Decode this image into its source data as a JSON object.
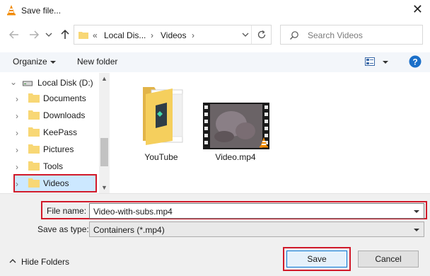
{
  "window": {
    "title": "Save file...",
    "icon": "vlc-cone-icon"
  },
  "nav": {
    "back_icon": "arrow-left-icon",
    "forward_icon": "arrow-right-icon",
    "recent_icon": "chevron-down-icon",
    "up_icon": "arrow-up-icon",
    "address": {
      "overflow": "«",
      "crumb1": "Local Dis...",
      "sep": "›",
      "crumb2": "Videos",
      "sep2": "›"
    },
    "search_placeholder": "Search Videos"
  },
  "toolbar": {
    "organize_label": "Organize",
    "new_folder_label": "New folder",
    "view_icon": "view-options-icon",
    "help_icon": "help-icon"
  },
  "tree": {
    "drive_label": "Local Disk (D:)",
    "items": [
      {
        "label": "Documents"
      },
      {
        "label": "Downloads"
      },
      {
        "label": "KeePass"
      },
      {
        "label": "Pictures"
      },
      {
        "label": "Tools"
      },
      {
        "label": "Videos",
        "selected": true
      }
    ]
  },
  "files": [
    {
      "name": "YouTube",
      "type": "folder"
    },
    {
      "name": "Video.mp4",
      "type": "video"
    }
  ],
  "form": {
    "file_name_label": "File name:",
    "file_name_value": "Video-with-subs.mp4",
    "save_as_type_label": "Save as type:",
    "save_as_type_value": "Containers (*.mp4)"
  },
  "buttons": {
    "save": "Save",
    "cancel": "Cancel"
  },
  "hide_folders_label": "Hide Folders",
  "colors": {
    "highlight": "#d11a2a",
    "selection": "#cce8ff",
    "folder": "#f8d775",
    "help": "#1a6fc9"
  }
}
